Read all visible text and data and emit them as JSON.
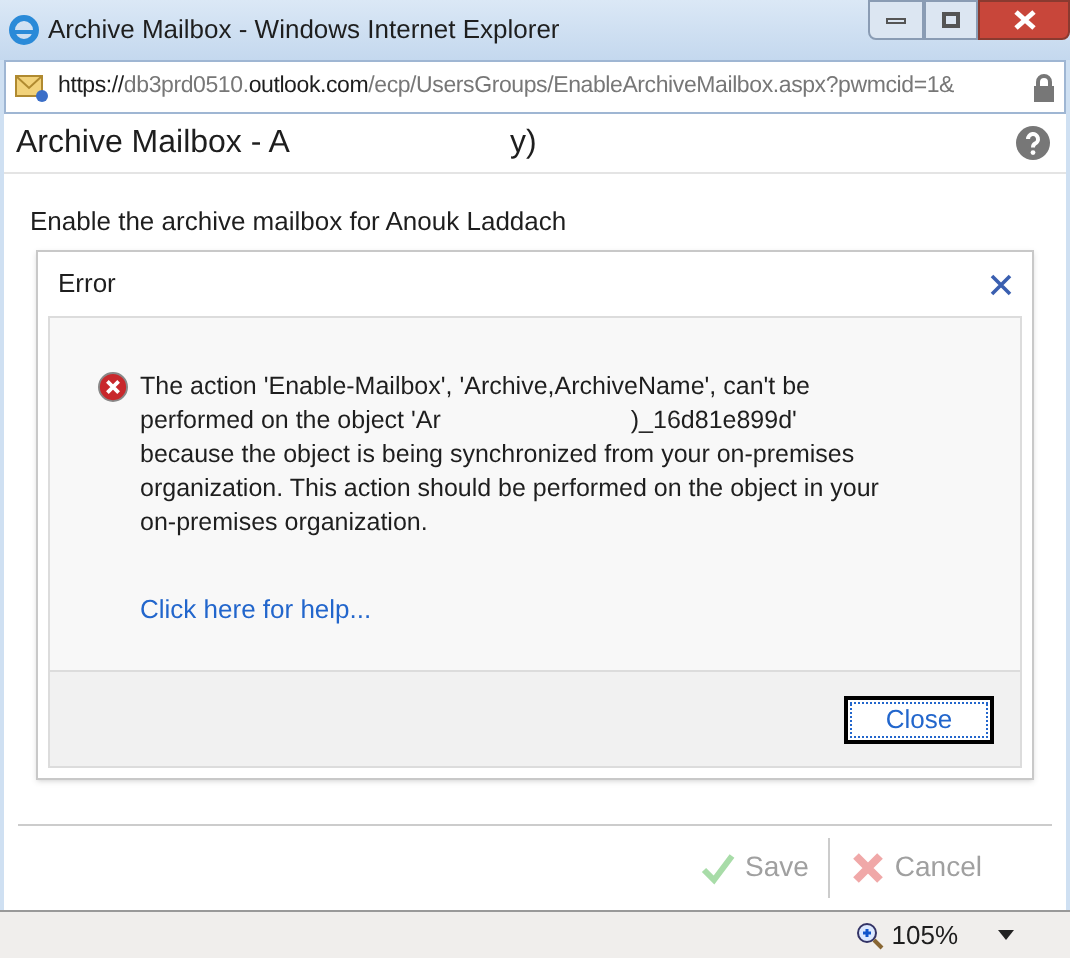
{
  "window": {
    "title": "Archive Mailbox - Windows Internet Explorer"
  },
  "address_bar": {
    "scheme": "https://",
    "host_prefix": "db3prd0510.",
    "domain": "outlook.com",
    "path": "/ecp/UsersGroups/EnableArchiveMailbox.aspx?pwmcid=1&"
  },
  "page": {
    "title_start": "Archive Mailbox - A",
    "title_end": "y)",
    "intro": "Enable the archive mailbox for Anouk Laddach"
  },
  "error_dialog": {
    "title": "Error",
    "message_lines": [
      {
        "text": "The action 'Enable-Mailbox', 'Archive,ArchiveName', can't be"
      },
      {
        "text": "performed on the object 'Ar",
        "after_gap": ")_16d81e899d'"
      },
      {
        "text": "because the object is being synchronized from your on-premises"
      },
      {
        "text": "organization. This action should be performed on the object in your"
      },
      {
        "text": "on-premises organization."
      }
    ],
    "help_link": "Click here for help...",
    "close_button": "Close"
  },
  "buttons": [
    {
      "label": "Save",
      "kind": "save",
      "disabled": true
    },
    {
      "label": "Cancel",
      "kind": "cancel",
      "disabled": true
    }
  ],
  "status_bar": {
    "zoom": "105%"
  }
}
